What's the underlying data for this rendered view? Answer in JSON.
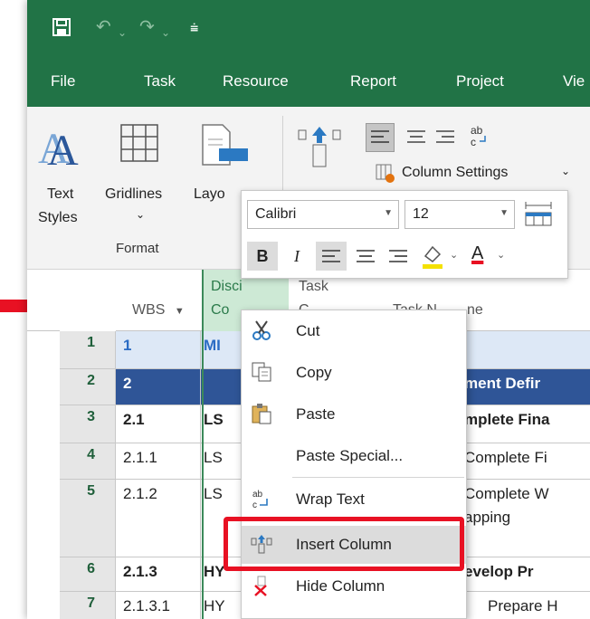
{
  "tabs": [
    "File",
    "Task",
    "Resource",
    "Report",
    "Project",
    "Vie"
  ],
  "ribbon": {
    "text_styles": "Text",
    "text_styles_2": "Styles",
    "gridlines": "Gridlines",
    "gridlines_dd": "⌄",
    "layout": "Layo",
    "format_group": "Format",
    "column_settings": "Column Settings",
    "column_settings_dd": "⌄"
  },
  "mini_toolbar": {
    "font": "Calibri",
    "size": "12",
    "bold": "B",
    "italic": "I",
    "font_color_label": "A"
  },
  "columns": {
    "wbs": "WBS",
    "disc_1": "Disci",
    "disc_2": "Co",
    "task_1": "Task",
    "task_2": "C",
    "task_name_1": "Task N",
    "task_name_2": "ne"
  },
  "rows": [
    {
      "num": "1",
      "wbs": "1",
      "disc": "MI",
      "name": ""
    },
    {
      "num": "2",
      "wbs": "2",
      "disc": "",
      "name": "ment Defir"
    },
    {
      "num": "3",
      "wbs": "2.1",
      "disc": "LS",
      "name": "mplete Fina"
    },
    {
      "num": "4",
      "wbs": "2.1.1",
      "disc": "LS",
      "name": "Complete Fi"
    },
    {
      "num": "5",
      "wbs": "2.1.2",
      "disc": "LS",
      "name": "Complete W",
      "name2": "apping"
    },
    {
      "num": "6",
      "wbs": "2.1.3",
      "disc": "HY",
      "name": "evelop Pr"
    },
    {
      "num": "7",
      "wbs": "2.1.3.1",
      "disc": "HY",
      "name": "Prepare H"
    }
  ],
  "context_menu": {
    "cut": "Cut",
    "copy": "Copy",
    "paste": "Paste",
    "paste_special": "Paste Special...",
    "wrap_text": "Wrap Text",
    "insert_column": "Insert Column",
    "hide_column": "Hide Column"
  },
  "colors": {
    "app_green": "#217346",
    "highlight_red": "#e81123",
    "row2_fill": "#2f5597",
    "wbs1_text": "#4472c4"
  }
}
